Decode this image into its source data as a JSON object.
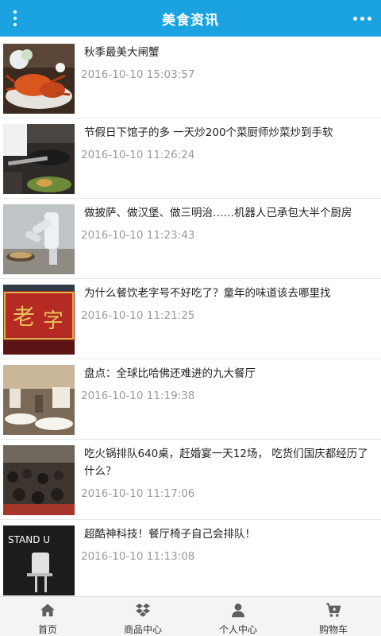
{
  "header": {
    "title": "美食资讯",
    "menu_icon": "vertical-dots-icon",
    "more_icon": "horizontal-dots-icon",
    "color": "#1aa3e0"
  },
  "news": [
    {
      "title": "秋季最美大闸蟹",
      "date": "2016-10-10 15:03:57",
      "image": "crab-dish-photo"
    },
    {
      "title": "节假日下馆子的多 一天炒200个菜厨师炒菜炒到手软",
      "date": "2016-10-10 11:26:24",
      "image": "chef-wok-photo"
    },
    {
      "title": "做披萨、做汉堡、做三明治……机器人已承包大半个厨房",
      "date": "2016-10-10 11:23:43",
      "image": "kitchen-robot-photo"
    },
    {
      "title": "为什么餐饮老字号不好吃了？童年的味道该去哪里找",
      "date": "2016-10-10 11:21:25",
      "image": "old-brand-sign-photo"
    },
    {
      "title": "盘点：全球比哈佛还难进的九大餐厅",
      "date": "2016-10-10 11:19:38",
      "image": "restaurant-interior-photo"
    },
    {
      "title": "吃火锅排队640桌，赶婚宴一天12场， 吃货们国庆都经历了什么？",
      "date": "2016-10-10 11:17:06",
      "image": "crowded-restaurant-photo"
    },
    {
      "title": "超酷神科技！餐厅椅子自己会排队！",
      "date": "2016-10-10 11:13:08",
      "image": "stand-up-chair-photo",
      "image_text": "STAND U"
    }
  ],
  "tabbar": {
    "items": [
      {
        "label": "首页",
        "icon": "home-icon"
      },
      {
        "label": "商品中心",
        "icon": "dropbox-icon"
      },
      {
        "label": "个人中心",
        "icon": "user-icon"
      },
      {
        "label": "购物车",
        "icon": "cart-icon"
      }
    ]
  }
}
